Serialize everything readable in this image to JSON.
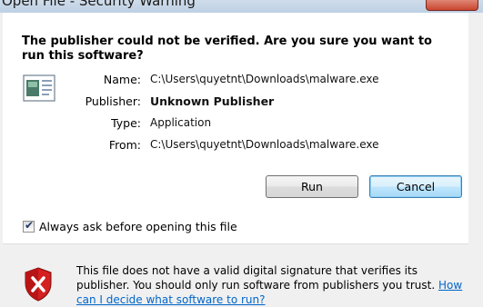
{
  "window": {
    "title": "Open File - Security Warning",
    "close_icon": "close-icon"
  },
  "headline": "The publisher could not be verified.  Are you sure you want to run this software?",
  "file_icon": "application-file-icon",
  "fields": [
    {
      "label": "Name:",
      "value": "C:\\Users\\quyetnt\\Downloads\\malware.exe"
    },
    {
      "label": "Publisher:",
      "value": "Unknown Publisher"
    },
    {
      "label": "Type:",
      "value": "Application"
    },
    {
      "label": "From:",
      "value": "C:\\Users\\quyetnt\\Downloads\\malware.exe"
    }
  ],
  "buttons": {
    "run": "Run",
    "cancel": "Cancel"
  },
  "checkbox": {
    "label": "Always ask before opening this file",
    "checked": true
  },
  "footer": {
    "icon": "security-shield-error-icon",
    "text": "This file does not have a valid digital signature that verifies its publisher. You should only run software from publishers you trust.  ",
    "link": "How can I decide what software to run?"
  },
  "colors": {
    "link": "#0066cc",
    "shield_red": "#d42020",
    "default_button_border": "#3c7fb1"
  }
}
